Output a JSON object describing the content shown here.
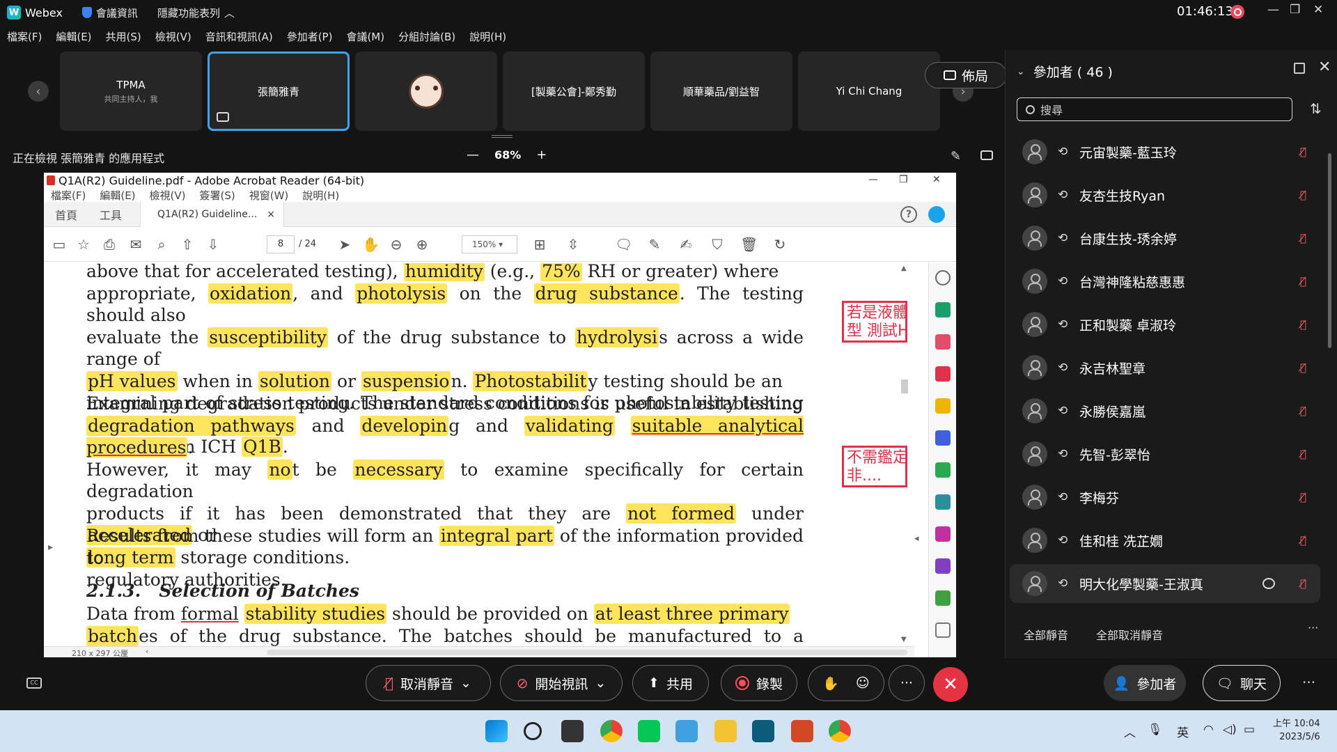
{
  "titlebar": {
    "app_name": "Webex",
    "meeting_info": "會議資訊",
    "hide_menu": "隱藏功能表列",
    "time": "01:46:13"
  },
  "menu": [
    "檔案(F)",
    "編輯(E)",
    "共用(S)",
    "檢視(V)",
    "音訊和視訊(A)",
    "參加者(P)",
    "會議(M)",
    "分組討論(B)",
    "說明(H)"
  ],
  "thumbnails": [
    {
      "name": "TPMA",
      "sub": "共同主持人，我"
    },
    {
      "name": "張簡雅青",
      "sub": ""
    },
    {
      "name": "",
      "sub": ""
    },
    {
      "name": "[製藥公會]-鄭秀勤",
      "sub": ""
    },
    {
      "name": "順華藥品/劉益智",
      "sub": ""
    },
    {
      "name": "Yi Chi Chang",
      "sub": ""
    }
  ],
  "layout_label": "佈局",
  "viewing": {
    "text": "正在檢視 張簡雅青 的應用程式",
    "zoom": "68%"
  },
  "acrobat": {
    "title": "Q1A(R2) Guideline.pdf - Adobe Acrobat Reader (64-bit)",
    "menu": [
      "檔案(F)",
      "編輯(E)",
      "檢視(V)",
      "簽署(S)",
      "視窗(W)",
      "說明(H)"
    ],
    "tab_home": "首頁",
    "tab_tools": "工具",
    "tab_doc": "Q1A(R2) Guideline...",
    "page_current": "8",
    "page_total": "/ 24",
    "zoom": "150%",
    "paper_size": "210 x 297 公厘"
  },
  "document": {
    "para1": [
      [
        "above that for accelerated testing), ",
        "humidity",
        " (e.g., ",
        "75%",
        " RH or greater) where"
      ],
      [
        "appropriate, ",
        "oxidation",
        ", and ",
        "photolysis",
        " on the ",
        "drug substance",
        ". The testing should also"
      ],
      [
        "evaluate the ",
        "susceptibility",
        " of the drug substance to ",
        "hydrolysi",
        "s across a wide range of"
      ],
      [
        "",
        "pH values",
        " when in ",
        "solution",
        " or ",
        "suspensio",
        "n. ",
        "Photostabilit",
        "y testing should be an"
      ],
      [
        "integral part of stress testing. The standard conditions for photostability testing are"
      ],
      [
        "described in ICH ",
        "Q1B",
        "."
      ]
    ],
    "para2": [
      [
        "Examining degradation products under stress conditions is useful in establishing"
      ],
      [
        "",
        "degradation pathways",
        " and ",
        "developin",
        "g and ",
        "validating",
        " ",
        "suitable analytical procedures",
        "."
      ],
      [
        "However, it may ",
        "no",
        "t be ",
        "necessary",
        " to examine specifically for certain degradation"
      ],
      [
        "products if it has been demonstrated that they are ",
        "not formed",
        " under ",
        "accelerated",
        " or"
      ],
      [
        "",
        "long term",
        " storage conditions."
      ]
    ],
    "para3": [
      [
        "Results from these studies will form an ",
        "integral part",
        " of the information provided to"
      ],
      [
        "regulatory authorities."
      ]
    ],
    "heading_num": "2.1.3.",
    "heading": "Selection of Batches",
    "para4": [
      [
        "Data from ",
        "formal",
        " ",
        "stability studies",
        " should be provided on ",
        "at least three primary"
      ],
      [
        "",
        "batch",
        "es of the drug substance. The batches should be manufactured to a minimum of"
      ]
    ],
    "note1": "若是液體劑型 測試HOLD",
    "note1_line1": "若是液體劑",
    "note1_line2": "型 測試HOl",
    "note2_line1": "不需鑑定除",
    "note2_line2": "非...."
  },
  "participants": {
    "header": "參加者 ( 46 )",
    "search_placeholder": "搜尋",
    "list": [
      "元宙製藥-藍玉玲",
      "友杏生技Ryan",
      "台康生技-琇余婷",
      "台灣神隆粘慈惠惠",
      "正和製藥 卓淑玲",
      "永吉林聖章",
      "永勝侯嘉嵐",
      "先智-彭翠怡",
      "李梅芬",
      "佳和桂 冼芷嫺",
      "明大化學製藥-王淑真"
    ],
    "mute_all": "全部靜音",
    "unmute_all": "全部取消靜音"
  },
  "controls": {
    "unmute": "取消靜音",
    "start_video": "開始視訊",
    "share": "共用",
    "record": "錄製",
    "participants": "參加者",
    "chat": "聊天"
  },
  "taskbar": {
    "ime": "英",
    "time": "上午 10:04",
    "date": "2023/5/6"
  },
  "colors": {
    "highlight": "#ffe45c",
    "annotation": "#e0304a",
    "end_call": "#e63343",
    "active_border": "#3aa6f5"
  }
}
